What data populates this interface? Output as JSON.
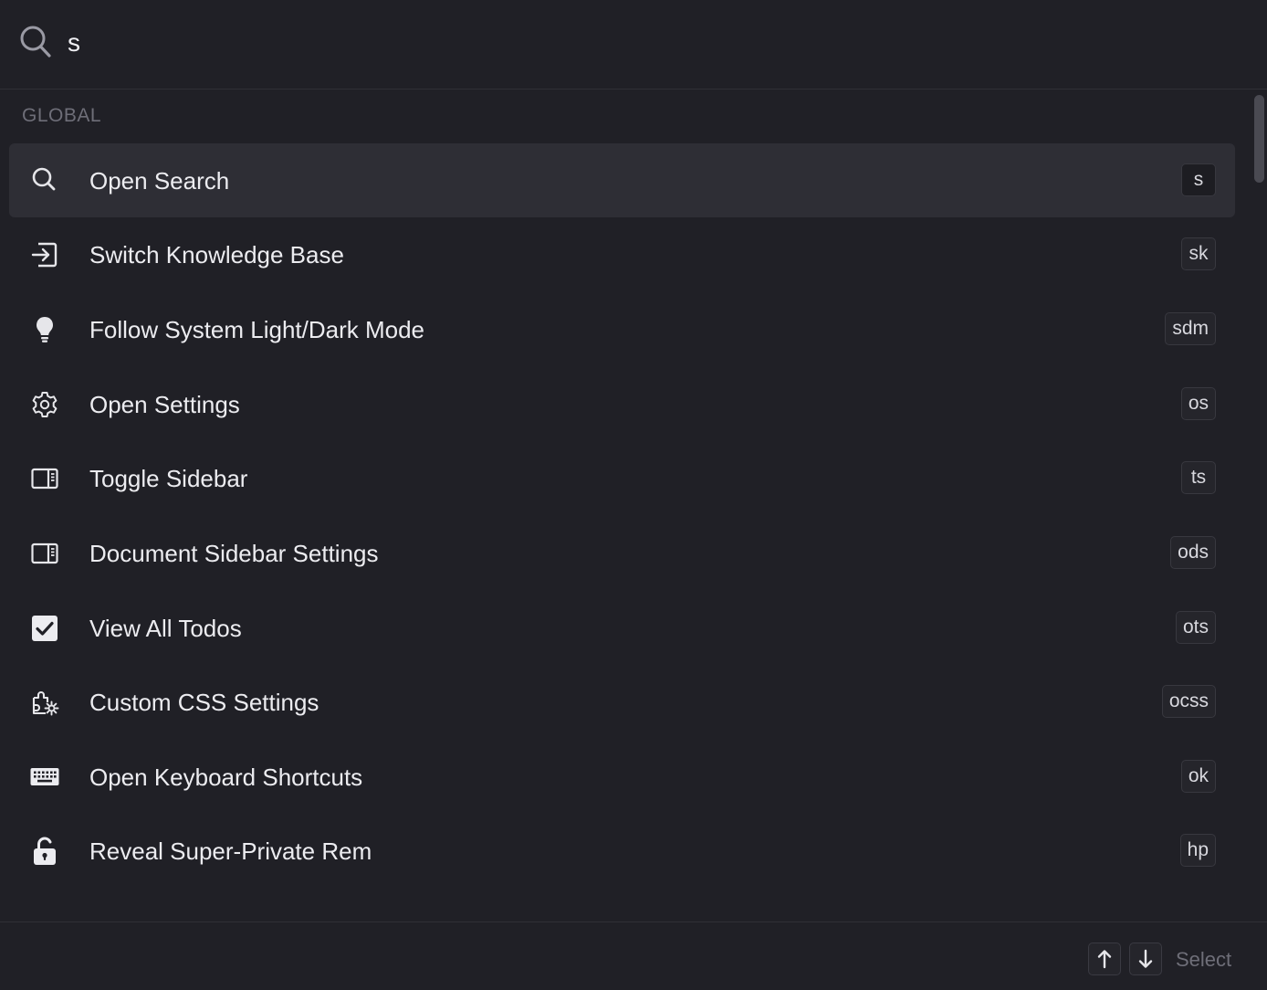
{
  "search": {
    "value": "s",
    "icon": "search-icon"
  },
  "section": {
    "title": "GLOBAL"
  },
  "commands": [
    {
      "label": "Open Search",
      "shortcut": "s",
      "icon": "search-icon",
      "selected": true
    },
    {
      "label": "Switch Knowledge Base",
      "shortcut": "sk",
      "icon": "enter-arrow-icon",
      "selected": false
    },
    {
      "label": "Follow System Light/Dark Mode",
      "shortcut": "sdm",
      "icon": "lightbulb-icon",
      "selected": false
    },
    {
      "label": "Open Settings",
      "shortcut": "os",
      "icon": "gear-icon",
      "selected": false
    },
    {
      "label": "Toggle Sidebar",
      "shortcut": "ts",
      "icon": "sidebar-icon",
      "selected": false
    },
    {
      "label": "Document Sidebar Settings",
      "shortcut": "ods",
      "icon": "sidebar-icon",
      "selected": false
    },
    {
      "label": "View All Todos",
      "shortcut": "ots",
      "icon": "checkbox-icon",
      "selected": false
    },
    {
      "label": "Custom CSS Settings",
      "shortcut": "ocss",
      "icon": "puzzle-gear-icon",
      "selected": false
    },
    {
      "label": "Open Keyboard Shortcuts",
      "shortcut": "ok",
      "icon": "keyboard-icon",
      "selected": false
    },
    {
      "label": "Reveal Super-Private Rem",
      "shortcut": "hp",
      "icon": "unlock-icon",
      "selected": false
    }
  ],
  "footer": {
    "up_icon": "arrow-up-icon",
    "down_icon": "arrow-down-icon",
    "select_label": "Select"
  },
  "colors": {
    "background": "#202026",
    "selected_row": "#2e2e35",
    "text": "#ececf0",
    "muted": "#6e6e78"
  }
}
